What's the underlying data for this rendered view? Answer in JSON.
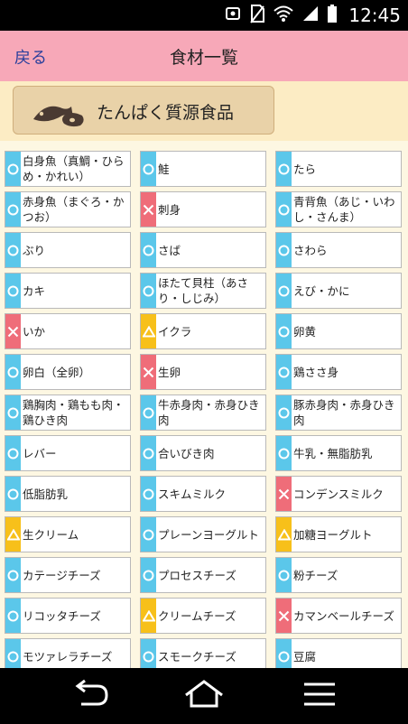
{
  "status": {
    "time": "12:45",
    "battery_level": "73"
  },
  "header": {
    "back_label": "戻る",
    "title": "食材一覧"
  },
  "category": {
    "label": "たんぱく質源食品",
    "icon": "fish-and-meat-icon"
  },
  "legend_colors": {
    "circle": "#5bc7ea",
    "cross": "#ef6d79",
    "triangle": "#f7c01a"
  },
  "foods": [
    {
      "name": "白身魚（真鯛・ひらめ・かれい）",
      "mark": "circle"
    },
    {
      "name": "鮭",
      "mark": "circle"
    },
    {
      "name": "たら",
      "mark": "circle"
    },
    {
      "name": "赤身魚（まぐろ・かつお）",
      "mark": "circle"
    },
    {
      "name": "刺身",
      "mark": "cross"
    },
    {
      "name": "青背魚（あじ・いわし・さんま）",
      "mark": "circle"
    },
    {
      "name": "ぶり",
      "mark": "circle"
    },
    {
      "name": "さば",
      "mark": "circle"
    },
    {
      "name": "さわら",
      "mark": "circle"
    },
    {
      "name": "カキ",
      "mark": "circle"
    },
    {
      "name": "ほたて貝柱（あさり・しじみ）",
      "mark": "circle"
    },
    {
      "name": "えび・かに",
      "mark": "circle"
    },
    {
      "name": "いか",
      "mark": "cross"
    },
    {
      "name": "イクラ",
      "mark": "triangle"
    },
    {
      "name": "卵黄",
      "mark": "circle"
    },
    {
      "name": "卵白（全卵）",
      "mark": "circle"
    },
    {
      "name": "生卵",
      "mark": "cross"
    },
    {
      "name": "鶏ささ身",
      "mark": "circle"
    },
    {
      "name": "鶏胸肉・鶏もも肉・鶏ひき肉",
      "mark": "circle"
    },
    {
      "name": "牛赤身肉・赤身ひき肉",
      "mark": "circle"
    },
    {
      "name": "豚赤身肉・赤身ひき肉",
      "mark": "circle"
    },
    {
      "name": "レバー",
      "mark": "circle"
    },
    {
      "name": "合いびき肉",
      "mark": "circle"
    },
    {
      "name": "牛乳・無脂肪乳",
      "mark": "circle"
    },
    {
      "name": "低脂肪乳",
      "mark": "circle"
    },
    {
      "name": "スキムミルク",
      "mark": "circle"
    },
    {
      "name": "コンデンスミルク",
      "mark": "cross"
    },
    {
      "name": "生クリーム",
      "mark": "triangle"
    },
    {
      "name": "プレーンヨーグルト",
      "mark": "circle"
    },
    {
      "name": "加糖ヨーグルト",
      "mark": "triangle"
    },
    {
      "name": "カテージチーズ",
      "mark": "circle"
    },
    {
      "name": "プロセスチーズ",
      "mark": "circle"
    },
    {
      "name": "粉チーズ",
      "mark": "circle"
    },
    {
      "name": "リコッタチーズ",
      "mark": "circle"
    },
    {
      "name": "クリームチーズ",
      "mark": "triangle"
    },
    {
      "name": "カマンベールチーズ",
      "mark": "cross"
    },
    {
      "name": "モツァレラチーズ",
      "mark": "circle"
    },
    {
      "name": "スモークチーズ",
      "mark": "circle"
    },
    {
      "name": "豆腐",
      "mark": "circle"
    }
  ]
}
